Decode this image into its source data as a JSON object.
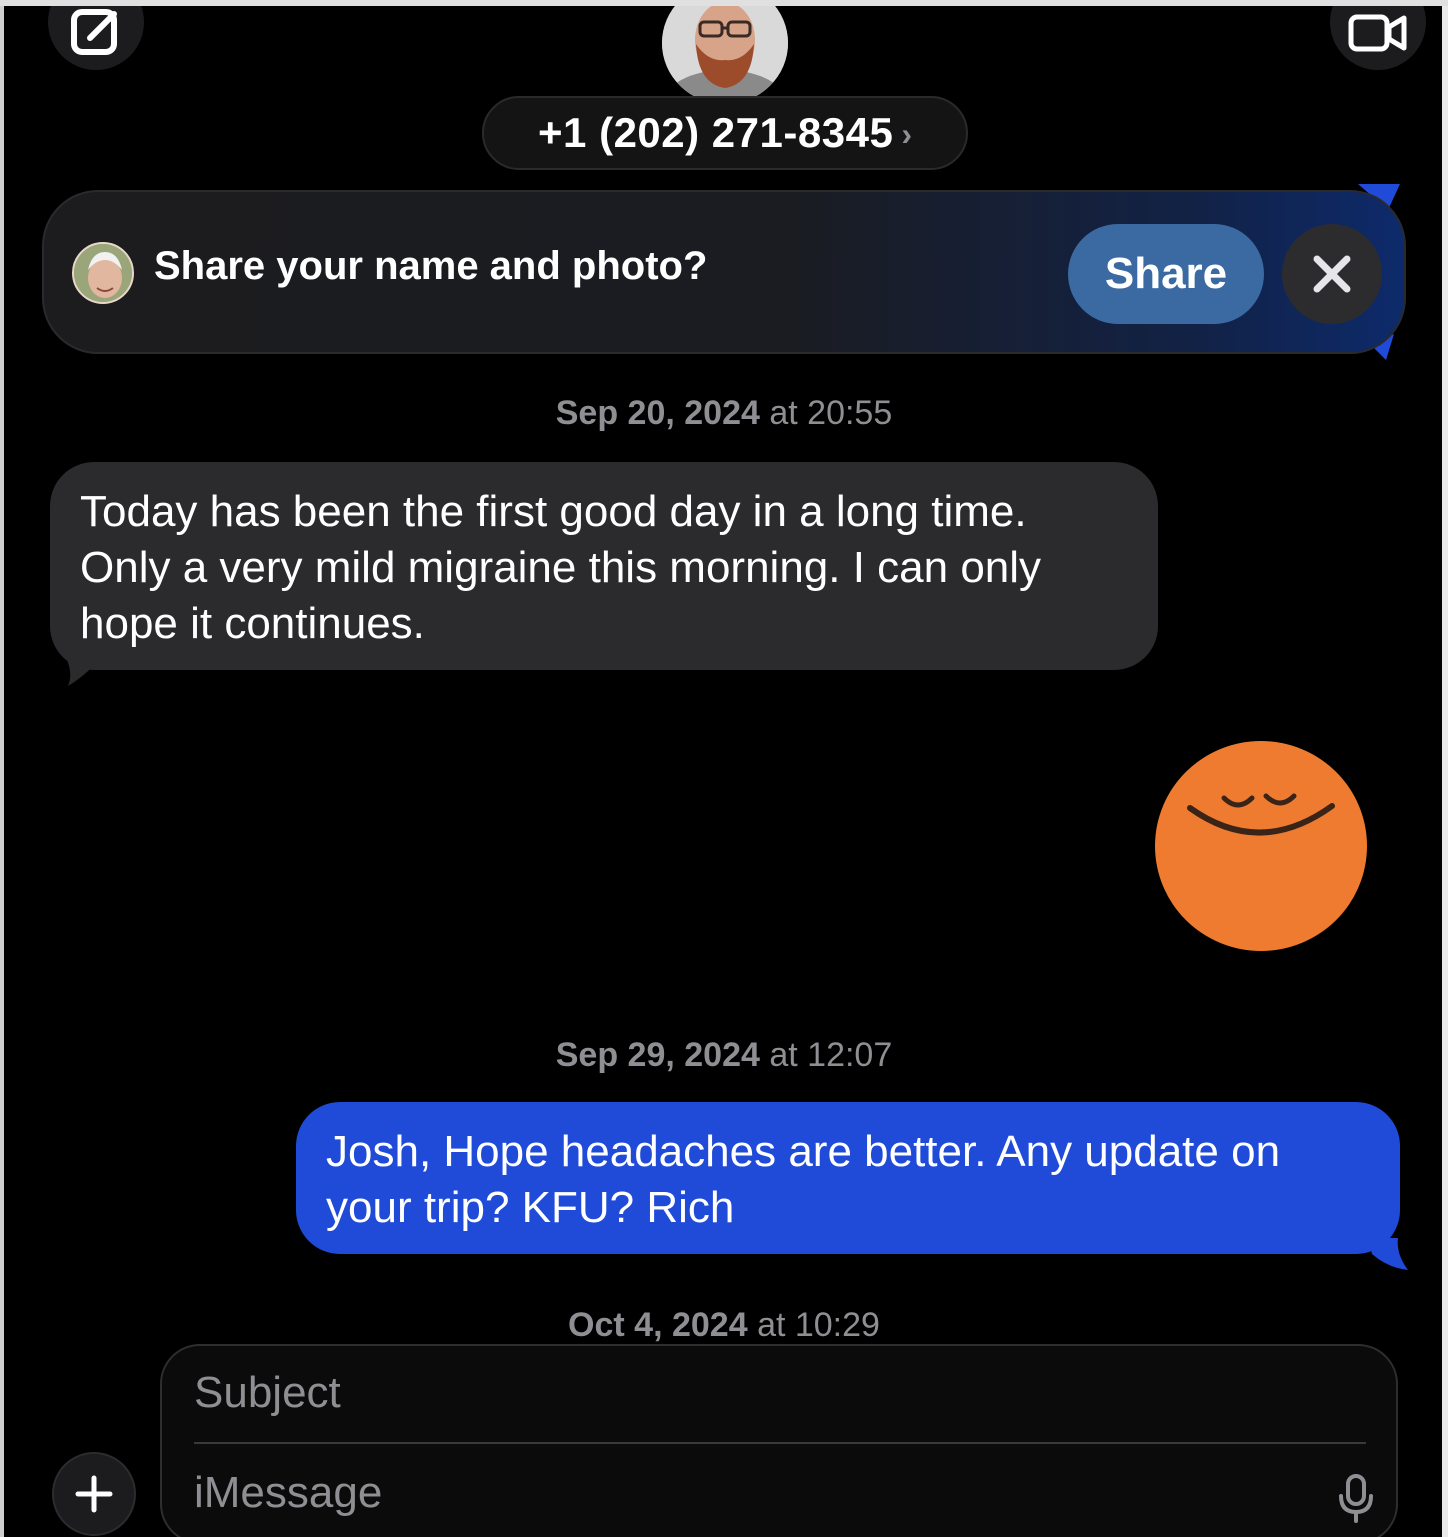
{
  "header": {
    "contact_number": "+1 (202) 271-8345",
    "chevron": "›",
    "compose_icon": "compose-icon",
    "video_icon": "video-camera-icon"
  },
  "share_banner": {
    "prompt": "Share your name and photo?",
    "share_label": "Share",
    "close_icon": "close-icon"
  },
  "conversation": {
    "timestamps": [
      {
        "date": "Sep 20, 2024",
        "time": "at 20:55"
      },
      {
        "date": "Sep 29, 2024",
        "time": "at 12:07"
      },
      {
        "date": "Oct 4, 2024",
        "time": "at 10:29"
      }
    ],
    "messages": [
      {
        "direction": "incoming",
        "text": "Today has been the first good day in a long time. Only a very mild migraine this morning. I can only hope it continues."
      },
      {
        "direction": "outgoing",
        "type": "sticker",
        "sticker": "smiling-orange-face-sticker"
      },
      {
        "direction": "outgoing",
        "text": "Josh, Hope headaches are better. Any update on your trip? KFU? Rich"
      }
    ]
  },
  "composer": {
    "subject_placeholder": "Subject",
    "message_placeholder": "iMessage",
    "plus_icon": "plus-icon",
    "mic_icon": "microphone-icon"
  },
  "colors": {
    "background": "#000000",
    "incoming_bubble": "#2b2b2d",
    "outgoing_bubble": "#1f4bd8",
    "share_button": "#3b6aa3",
    "sticker_orange": "#ee7b30"
  }
}
